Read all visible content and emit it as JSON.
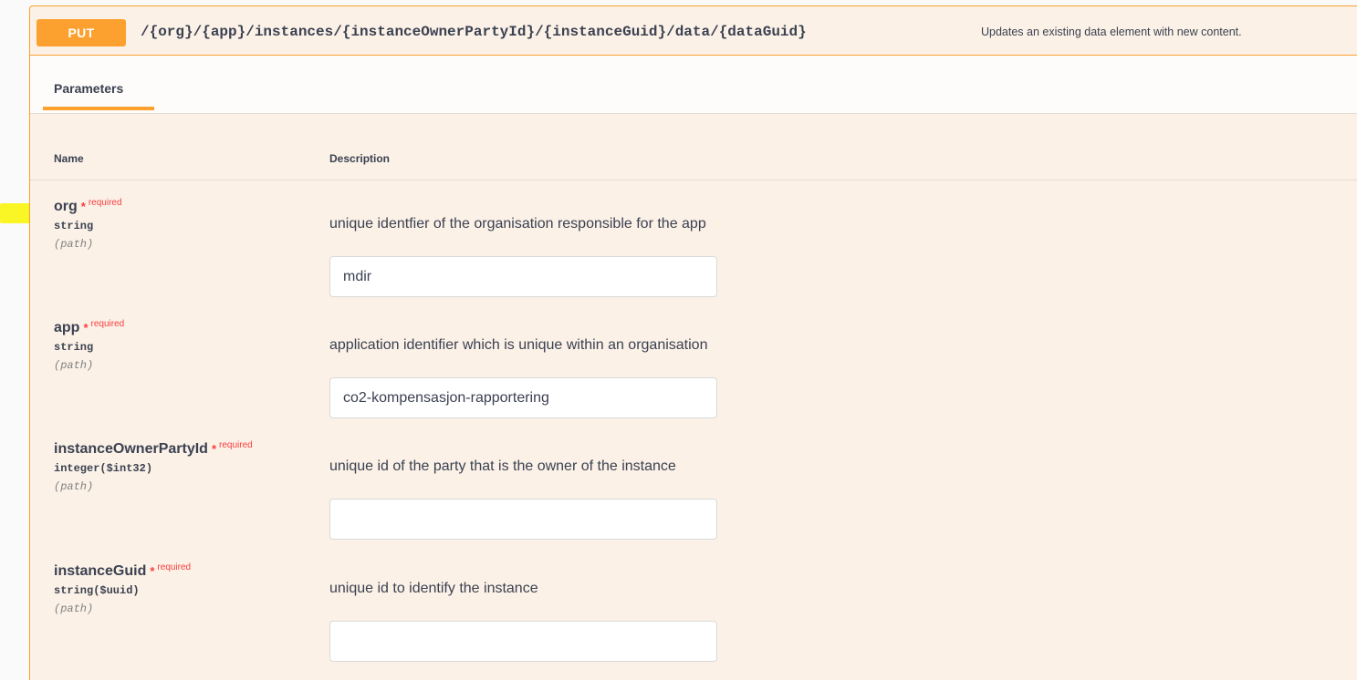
{
  "operation": {
    "method": "PUT",
    "path": "/{org}/{app}/instances/{instanceOwnerPartyId}/{instanceGuid}/data/{dataGuid}",
    "summary": "Updates an existing data element with new content."
  },
  "tabs": {
    "parameters_label": "Parameters"
  },
  "table": {
    "name_header": "Name",
    "description_header": "Description"
  },
  "required_star": "*",
  "required_label": "required",
  "parameters": [
    {
      "name": "org",
      "type": "string",
      "in": "(path)",
      "description": "unique identfier of the organisation responsible for the app",
      "value": "mdir",
      "placeholder": ""
    },
    {
      "name": "app",
      "type": "string",
      "in": "(path)",
      "description": "application identifier which is unique within an organisation",
      "value": "co2-kompensasjon-rapportering",
      "placeholder": ""
    },
    {
      "name": "instanceOwnerPartyId",
      "type": "integer($int32)",
      "in": "(path)",
      "description": "unique id of the party that is the owner of the instance",
      "value": "",
      "placeholder": ""
    },
    {
      "name": "instanceGuid",
      "type": "string($uuid)",
      "in": "(path)",
      "description": "unique id to identify the instance",
      "value": "",
      "placeholder": ""
    }
  ],
  "colors": {
    "accent": "#fca130",
    "block_background": "#fbf1e7",
    "required": "#f93e3e",
    "highlight": "#f9f400"
  }
}
